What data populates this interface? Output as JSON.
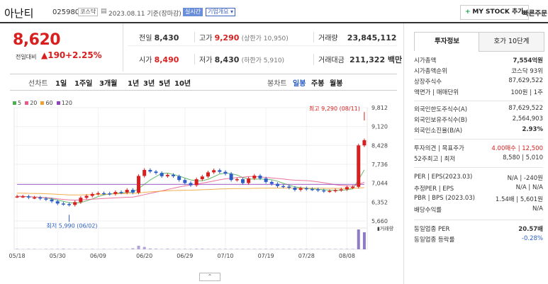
{
  "header": {
    "name": "아난티",
    "code": "025980",
    "market_badge": "코스닥",
    "date": "2023.08.11 기준(장마감)",
    "realtime_badge": "실시간",
    "company_badge": "기업개요",
    "mystock_button": "MY STOCK 추가",
    "quick_order_button": "빠른주문"
  },
  "quote": {
    "price": "8,620",
    "change_label": "전일대비",
    "change": "▲190",
    "change_pct": "+2.25%"
  },
  "summary": {
    "prev_label": "전일",
    "prev_value": "8,430",
    "high_label": "고가",
    "high_value": "9,290",
    "upper_limit": "(상한가 10,950)",
    "volume_label": "거래량",
    "volume_value": "23,845,112",
    "open_label": "시가",
    "open_value": "8,490",
    "low_label": "저가",
    "low_value": "8,430",
    "lower_limit": "(하한가 5,910)",
    "amount_label": "거래대금",
    "amount_value": "211,322 백만"
  },
  "periods": {
    "line_label": "선차트",
    "items": [
      "1일",
      "1주일",
      "3개월",
      "1년",
      "3년",
      "5년",
      "10년"
    ],
    "candle_label": "봉차트",
    "candle_items": [
      "일봉",
      "주봉",
      "월봉"
    ]
  },
  "chart_data": {
    "type": "candlestick",
    "legend": [
      {
        "name": "5",
        "color": "#4caf50"
      },
      {
        "name": "20",
        "color": "#e85a8a"
      },
      {
        "name": "60",
        "color": "#f0a030"
      },
      {
        "name": "120",
        "color": "#8e44c0"
      }
    ],
    "y_ticks": [
      "9,812",
      "9,120",
      "8,428",
      "7,736",
      "7,044",
      "6,352",
      "5,660"
    ],
    "ylim": [
      5660,
      9812
    ],
    "x_ticks": [
      "05/18",
      "05/30",
      "06/09",
      "06/20",
      "06/29",
      "07/10",
      "07/19",
      "07/28",
      "08/08"
    ],
    "annotation_high": "최고 9,290 (08/11)",
    "annotation_low": "최저 5,990 (06/02)",
    "volume_label": "거래량",
    "close": [
      6560,
      6560,
      6520,
      6520,
      6480,
      6450,
      6380,
      6300,
      6280,
      6250,
      6350,
      6510,
      6580,
      6650,
      6680,
      6670,
      6650,
      6720,
      6700,
      6800,
      6700,
      7310,
      7530,
      7470,
      7420,
      7300,
      7350,
      7300,
      7160,
      7050,
      6970,
      7190,
      7290,
      7440,
      7520,
      7460,
      7390,
      7160,
      7190,
      7050,
      7220,
      7320,
      7220,
      7090,
      7020,
      6940,
      6920,
      6880,
      6800,
      6860,
      6830,
      6820,
      6780,
      6750,
      6760,
      6790,
      6820,
      6900,
      6910,
      8430,
      8620
    ],
    "volume": [
      0.02,
      0.01,
      0.02,
      0.02,
      0.01,
      0.02,
      0.02,
      0.02,
      0.03,
      0.02,
      0.02,
      0.02,
      0.01,
      0.02,
      0.01,
      0.02,
      0.01,
      0.02,
      0.02,
      0.02,
      0.05,
      0.18,
      0.12,
      0.04,
      0.03,
      0.02,
      0.03,
      0.02,
      0.02,
      0.02,
      0.02,
      0.03,
      0.03,
      0.02,
      0.02,
      0.02,
      0.02,
      0.02,
      0.02,
      0.02,
      0.02,
      0.02,
      0.02,
      0.02,
      0.02,
      0.02,
      0.02,
      0.02,
      0.02,
      0.02,
      0.02,
      0.02,
      0.02,
      0.02,
      0.02,
      0.02,
      0.02,
      0.02,
      0.02,
      1.0,
      0.86
    ]
  },
  "side": {
    "tab_active": "투자정보",
    "tab_other": "호가 10단계",
    "rows": [
      {
        "label": "시가총액",
        "value": "7,554억원",
        "bold": true
      },
      {
        "label": "시가총액순위",
        "value": "코스닥 93위"
      },
      {
        "label": "상장주식수",
        "value": "87,629,522"
      },
      {
        "label": "액면가 | 매매단위",
        "value": "100원 | 1주"
      },
      {
        "label": "외국인한도주식수(A)",
        "value": "87,629,522"
      },
      {
        "label": "외국인보유주식수(B)",
        "value": "2,564,903"
      },
      {
        "label": "외국인소진율(B/A)",
        "value": "2.93%",
        "bold": true
      },
      {
        "label": "투자의견 | 목표주가",
        "value": "4.00매수 | 12,500"
      },
      {
        "label": "52주최고 | 최저",
        "value": "8,580 | 5,010"
      },
      {
        "label": "PER | EPS(2023.03)",
        "value": "N/A | -240원"
      },
      {
        "label": "추정PER | EPS",
        "value": "N/A | N/A"
      },
      {
        "label": "PBR | BPS (2023.03)",
        "value": "1.54배 | 5,601원"
      },
      {
        "label": "배당수익률",
        "value": "N/A"
      },
      {
        "label": "동일업종 PER",
        "value": "20.57배",
        "bold": true
      },
      {
        "label": "동일업종 등락률",
        "value": "-0.28%",
        "blue": true
      }
    ]
  },
  "colors": {
    "up": "#d81f1f",
    "down": "#2c5ec6",
    "accent": "#d81f1f"
  }
}
